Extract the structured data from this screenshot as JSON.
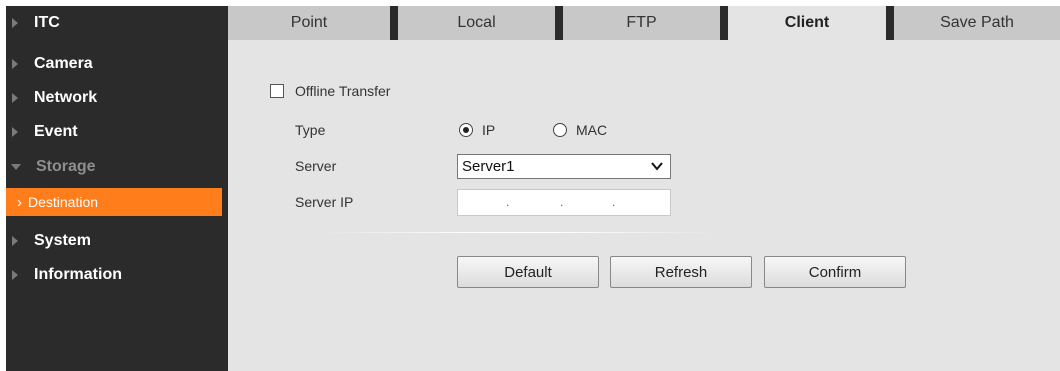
{
  "sidebar": {
    "items": [
      {
        "label": "ITC"
      },
      {
        "label": "Camera"
      },
      {
        "label": "Network"
      },
      {
        "label": "Event"
      },
      {
        "label": "Storage"
      },
      {
        "label": "System"
      },
      {
        "label": "Information"
      }
    ],
    "sub_items": [
      {
        "label": "Destination"
      }
    ],
    "active_color": "#ff7e1b"
  },
  "tabs": [
    {
      "label": "Point"
    },
    {
      "label": "Local"
    },
    {
      "label": "FTP"
    },
    {
      "label": "Client"
    },
    {
      "label": "Save Path"
    }
  ],
  "active_tab": "Client",
  "form": {
    "offline_transfer": {
      "label": "Offline Transfer",
      "checked": false
    },
    "type": {
      "label": "Type",
      "options": [
        "IP",
        "MAC"
      ],
      "selected": "IP"
    },
    "server": {
      "label": "Server",
      "value": "Server1"
    },
    "server_ip": {
      "label": "Server IP",
      "separator": "."
    }
  },
  "buttons": {
    "default": "Default",
    "refresh": "Refresh",
    "confirm": "Confirm"
  },
  "icons": {
    "collapsed": "triangle-right-icon",
    "expanded": "triangle-down-icon",
    "sub_item": "chevron-right-icon",
    "dropdown": "chevron-down-icon"
  }
}
